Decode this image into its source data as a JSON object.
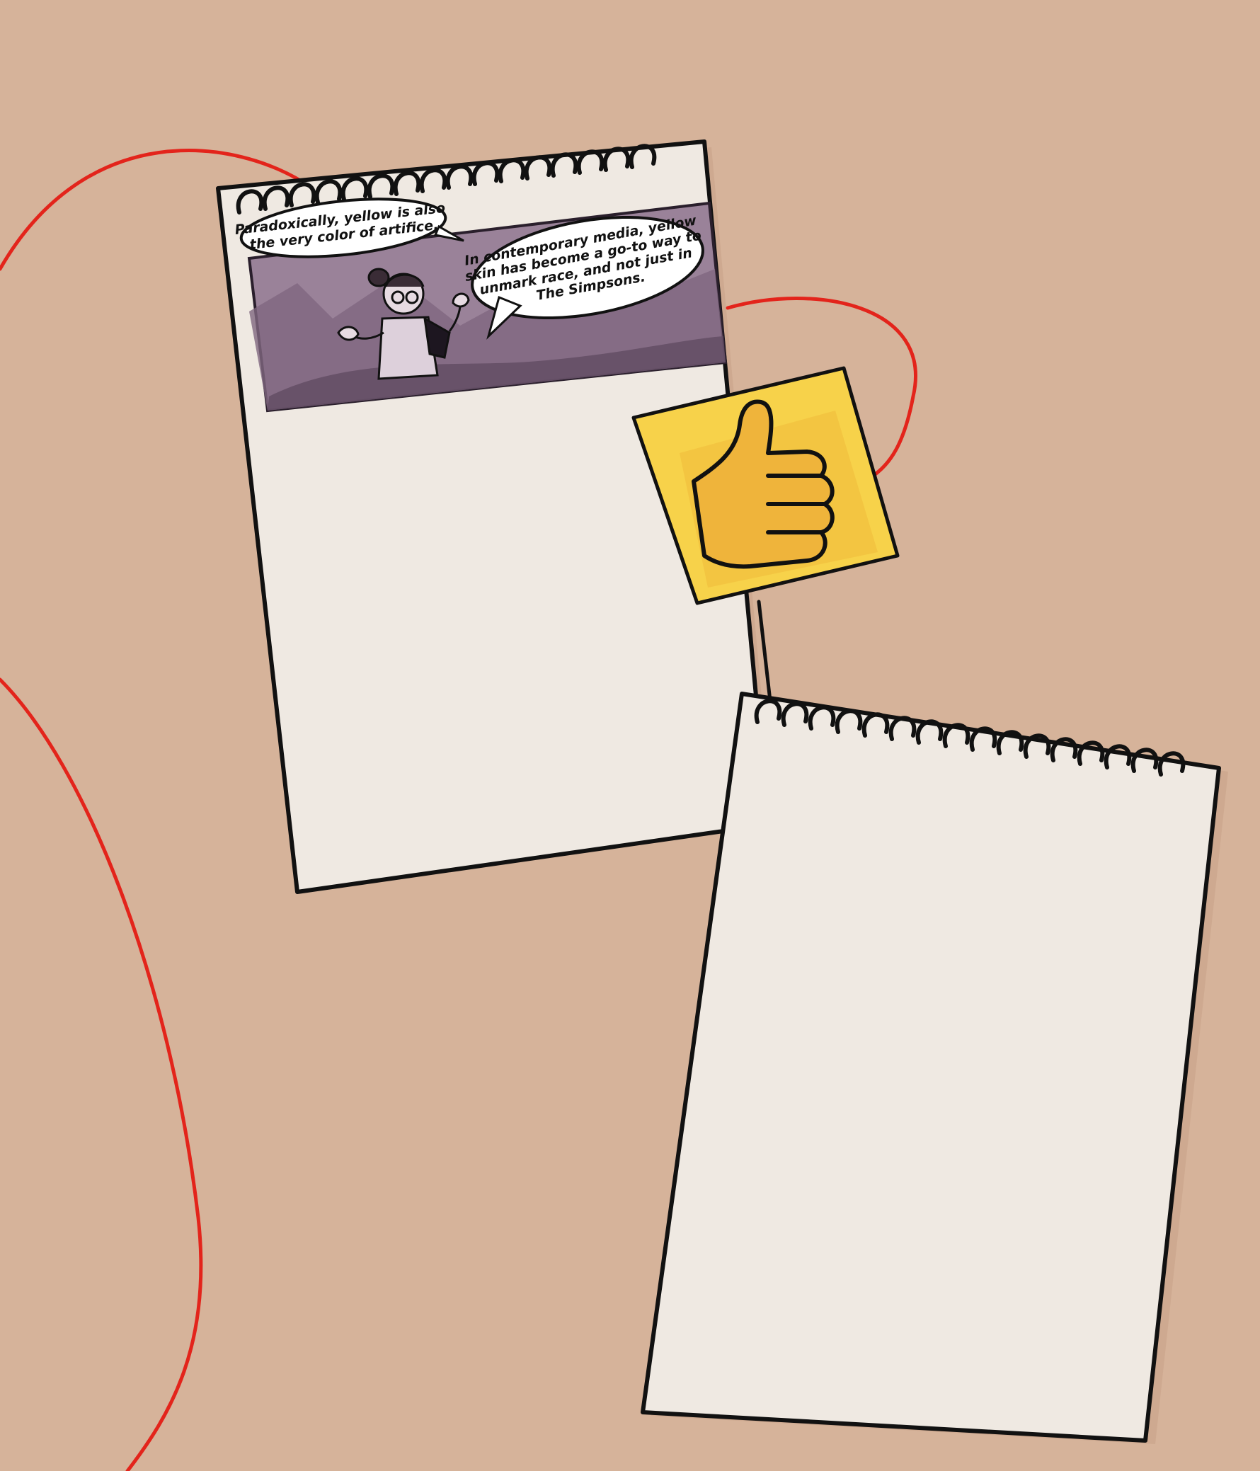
{
  "comic_panel": {
    "bubble_left": {
      "line1": "Paradoxically, yellow is also",
      "line2": "the very color of artifice."
    },
    "bubble_right": {
      "line1": "In contemporary media, yellow",
      "line2": "skin has become a go-to way to",
      "line3": "unmark race, and not just in",
      "line4": "The Simpsons."
    }
  },
  "icons": {
    "sticky_note": "thumbs-up-icon"
  },
  "colors": {
    "background": "#d6b39a",
    "paper": "#efe9e2",
    "ink": "#111111",
    "string": "#e3241b",
    "sticky": "#f7d24a",
    "panel": "#9a8299"
  }
}
